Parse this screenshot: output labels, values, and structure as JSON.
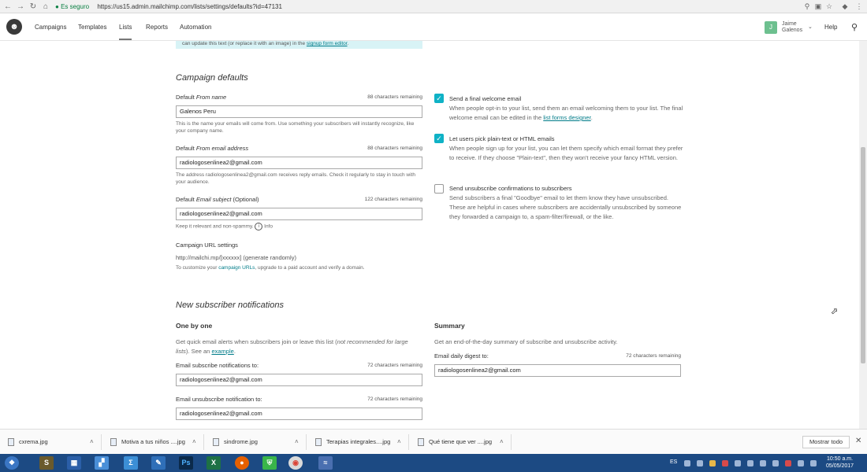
{
  "browser": {
    "secure_label": "Es seguro",
    "url": "https://us15.admin.mailchimp.com/lists/settings/defaults?id=47131"
  },
  "nav": {
    "items": [
      "Campaigns",
      "Templates",
      "Lists",
      "Reports",
      "Automation"
    ],
    "user_initial": "J",
    "user_line1": "Jaime",
    "user_line2": "Galenos",
    "help": "Help"
  },
  "infobox": {
    "text": "can update this text (or replace it with an image) in the ",
    "link": "signup form editor",
    "end": "."
  },
  "campaign_defaults": {
    "title": "Campaign defaults",
    "from_name": {
      "label_pre": "Default ",
      "label_em": "From name",
      "remaining": "88 characters remaining",
      "value": "Galenos Peru",
      "help": "This is the name your emails will come from. Use something your subscribers will instantly recognize, like your company name."
    },
    "from_email": {
      "label_pre": "Default ",
      "label_em": "From email address",
      "remaining": "88 characters remaining",
      "value": "radiologosenlinea2@gmail.com",
      "help": "The address radiologosenlinea2@gmail.com receives reply emails. Check it regularly to stay in touch with your audience."
    },
    "subject": {
      "label_pre": "Default ",
      "label_em": "Email subject",
      "label_post": " (Optional)",
      "remaining": "122 characters remaining",
      "value": "radiologosenlinea2@gmail.com",
      "help": "Keep it relevant and non-spammy.",
      "info": "Info"
    },
    "url_settings": {
      "label": "Campaign URL settings",
      "value": "http://mailchi.mp/[xxxxxx] (generate randomly)",
      "help_pre": "To customize your ",
      "help_link": "campaign URLs",
      "help_post": ", upgrade to a paid account and verify a domain."
    },
    "options": [
      {
        "checked": true,
        "title": "Send a final welcome email",
        "desc_pre": "When people opt-in to your list, send them an email welcoming them to your list. The final welcome email can be edited in the ",
        "desc_link": "list forms designer",
        "desc_post": "."
      },
      {
        "checked": true,
        "title": "Let users pick plain-text or HTML emails",
        "desc_pre": "When people sign up for your list, you can let them specify which email format they prefer to receive. If they choose \"Plain-text\", then they won't receive your fancy HTML version.",
        "desc_link": "",
        "desc_post": ""
      },
      {
        "checked": false,
        "title": "Send unsubscribe confirmations to subscribers",
        "desc_pre": "Send subscribers a final \"Goodbye\" email to let them know they have unsubscribed. These are helpful in cases where subscribers are accidentally unsubscribed by someone they forwarded a campaign to, a spam-filter/firewall, or the like.",
        "desc_link": "",
        "desc_post": ""
      }
    ]
  },
  "notifications": {
    "title": "New subscriber notifications",
    "one_by_one": {
      "heading": "One by one",
      "desc_pre": "Get quick email alerts when subscribers join or leave this list (",
      "desc_em": "not recommended for large lists",
      "desc_mid": "). See an ",
      "desc_link": "example",
      "desc_post": ".",
      "subscribe": {
        "label": "Email subscribe notifications to:",
        "remaining": "72 characters remaining",
        "value": "radiologosenlinea2@gmail.com"
      },
      "unsubscribe": {
        "label": "Email unsubscribe notification to:",
        "remaining": "72 characters remaining",
        "value": "radiologosenlinea2@gmail.com"
      }
    },
    "summary": {
      "heading": "Summary",
      "desc": "Get an end-of-the-day summary of subscribe and unsubscribe activity.",
      "label": "Email daily digest to:",
      "remaining": "72 characters remaining",
      "value": "radiologosenlinea2@gmail.com"
    }
  },
  "downloads": {
    "items": [
      "cxrema.jpg",
      "Motiva a tus niños ....jpg",
      "sindrome.jpg",
      "Terapias integrales....jpg",
      "Qué tiene que ver ....jpg"
    ],
    "show_all": "Mostrar todo"
  },
  "taskbar": {
    "lang": "ES",
    "time": "10:50 a.m.",
    "date": "05/05/2017"
  }
}
